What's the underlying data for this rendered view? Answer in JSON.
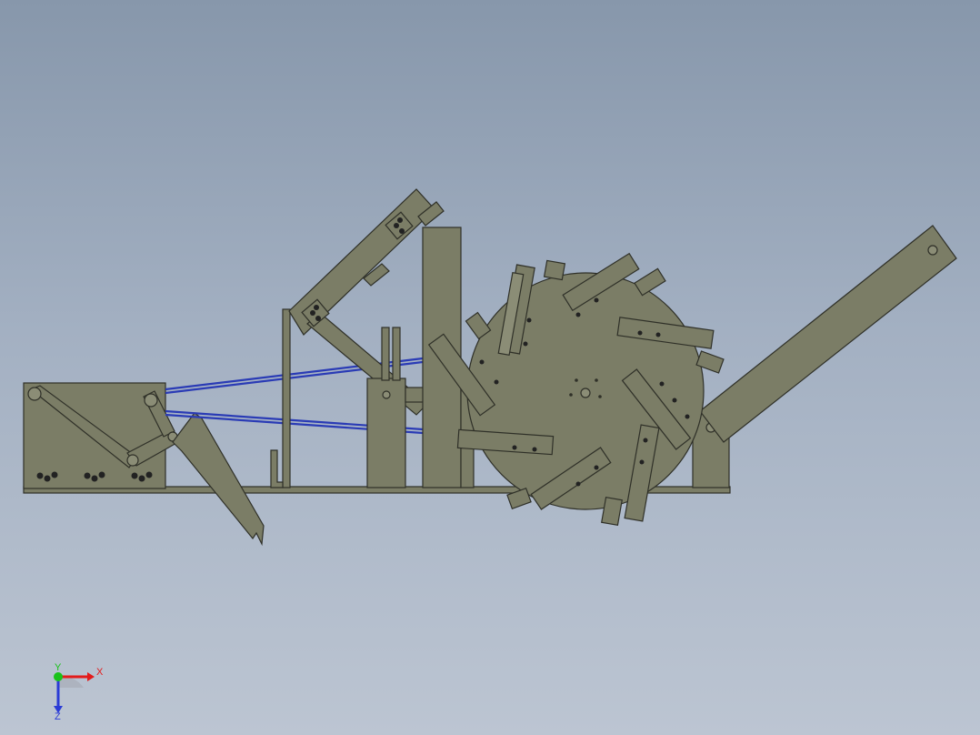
{
  "viewport": {
    "background_top": "#8797ab",
    "background_bottom": "#bcc5d2",
    "part_color": "#7b7d66",
    "part_stroke": "#2f3028",
    "belt_color": "#2a3bb5"
  },
  "triad": {
    "x_label": "X",
    "y_label": "Y",
    "z_label": "Z",
    "x_color": "#e31b1b",
    "y_color": "#19c21a",
    "z_color": "#2a3bd6"
  }
}
